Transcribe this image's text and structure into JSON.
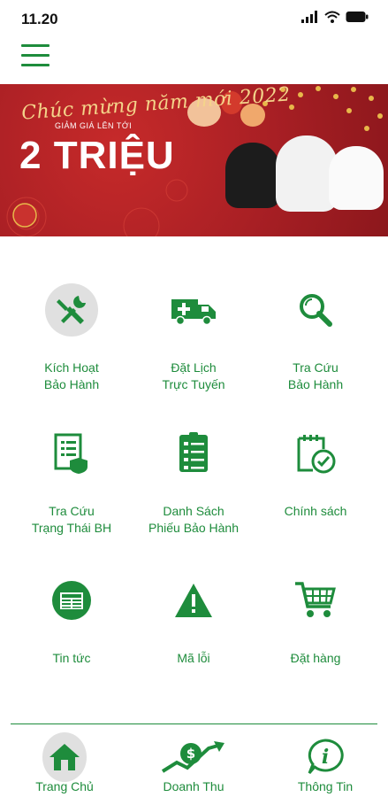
{
  "status_bar": {
    "time": "11.20"
  },
  "banner": {
    "greeting": "Chúc mừng năm mới 2022",
    "subtitle": "GIẢM GIÁ LÊN TỚI",
    "headline": "2 TRIỆU"
  },
  "menu": {
    "items": [
      {
        "label": "Kích Hoạt\nBảo Hành",
        "icon": "tools-icon"
      },
      {
        "label": "Đặt Lịch\nTrực Tuyến",
        "icon": "service-van-icon"
      },
      {
        "label": "Tra Cứu\nBảo Hành",
        "icon": "search-icon"
      },
      {
        "label": "Tra Cứu\nTrạng Thái BH",
        "icon": "document-shield-icon"
      },
      {
        "label": "Danh Sách\nPhiếu Bảo Hành",
        "icon": "checklist-icon"
      },
      {
        "label": "Chính sách",
        "icon": "calendar-check-icon"
      },
      {
        "label": "Tin tức",
        "icon": "newspaper-icon"
      },
      {
        "label": "Mã lỗi",
        "icon": "warning-icon"
      },
      {
        "label": "Đặt hàng",
        "icon": "shopping-cart-icon"
      }
    ]
  },
  "bottom_nav": {
    "items": [
      {
        "label": "Trang Chủ",
        "icon": "home-icon",
        "active": true
      },
      {
        "label": "Doanh Thu",
        "icon": "revenue-icon",
        "active": false
      },
      {
        "label": "Thông Tin",
        "icon": "info-icon",
        "active": false
      }
    ]
  },
  "colors": {
    "primary": "#1e8c3c",
    "banner_red": "#a81f24",
    "active_circle": "#e0e0e0"
  }
}
